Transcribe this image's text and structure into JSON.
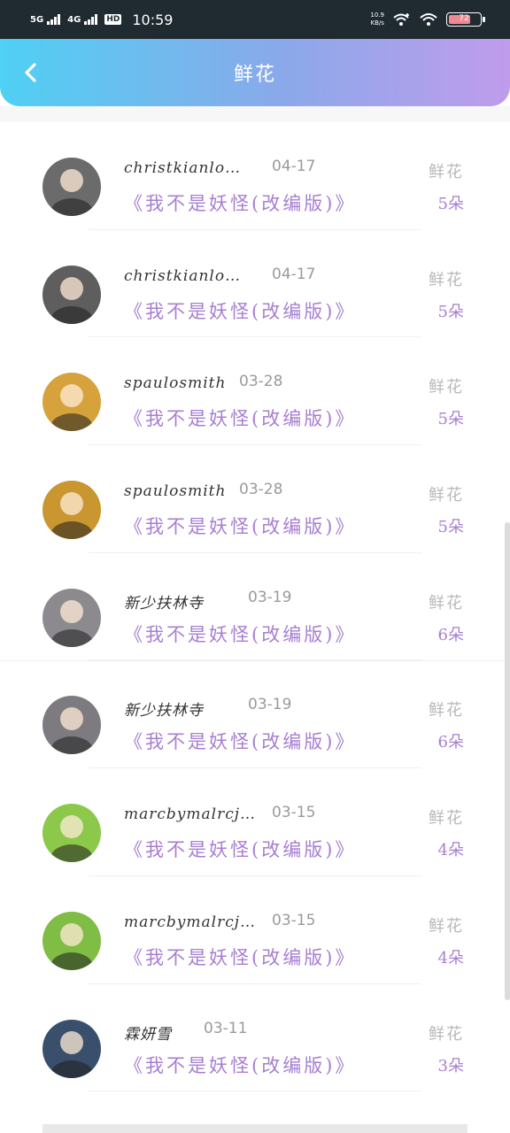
{
  "status_bar": {
    "net1": "5G",
    "net2": "4G",
    "hd": "HD",
    "time": "10:59",
    "speed_top": "10.9",
    "speed_bottom": "KB/s",
    "battery": "72"
  },
  "header": {
    "title": "鲜花"
  },
  "items": [
    {
      "name": "christkianlo…",
      "date": "04-17",
      "work": "《我不是妖怪(改编版)》",
      "label": "鲜花",
      "count": "5朵",
      "avatar_color": "#6b6b6b"
    },
    {
      "name": "christkianlo…",
      "date": "04-17",
      "work": "《我不是妖怪(改编版)》",
      "label": "鲜花",
      "count": "5朵",
      "avatar_color": "#5e5e5e"
    },
    {
      "name": "spaulosmith",
      "date": "03-28",
      "work": "《我不是妖怪(改编版)》",
      "label": "鲜花",
      "count": "5朵",
      "avatar_color": "#d6a23c"
    },
    {
      "name": "spaulosmith",
      "date": "03-28",
      "work": "《我不是妖怪(改编版)》",
      "label": "鲜花",
      "count": "5朵",
      "avatar_color": "#c9962f"
    },
    {
      "name": "新少扶林寺",
      "date": "03-19",
      "work": "《我不是妖怪(改编版)》",
      "label": "鲜花",
      "count": "6朵",
      "avatar_color": "#8c8a8f"
    },
    {
      "name": "新少扶林寺",
      "date": "03-19",
      "work": "《我不是妖怪(改编版)》",
      "label": "鲜花",
      "count": "6朵",
      "avatar_color": "#7d7b80"
    },
    {
      "name": "marcbymalrcj…",
      "date": "03-15",
      "work": "《我不是妖怪(改编版)》",
      "label": "鲜花",
      "count": "4朵",
      "avatar_color": "#8cc94b"
    },
    {
      "name": "marcbymalrcj…",
      "date": "03-15",
      "work": "《我不是妖怪(改编版)》",
      "label": "鲜花",
      "count": "4朵",
      "avatar_color": "#7fbd44"
    },
    {
      "name": "霖妍雪",
      "date": "03-11",
      "work": "《我不是妖怪(改编版)》",
      "label": "鲜花",
      "count": "3朵",
      "avatar_color": "#3a4f6b"
    }
  ]
}
